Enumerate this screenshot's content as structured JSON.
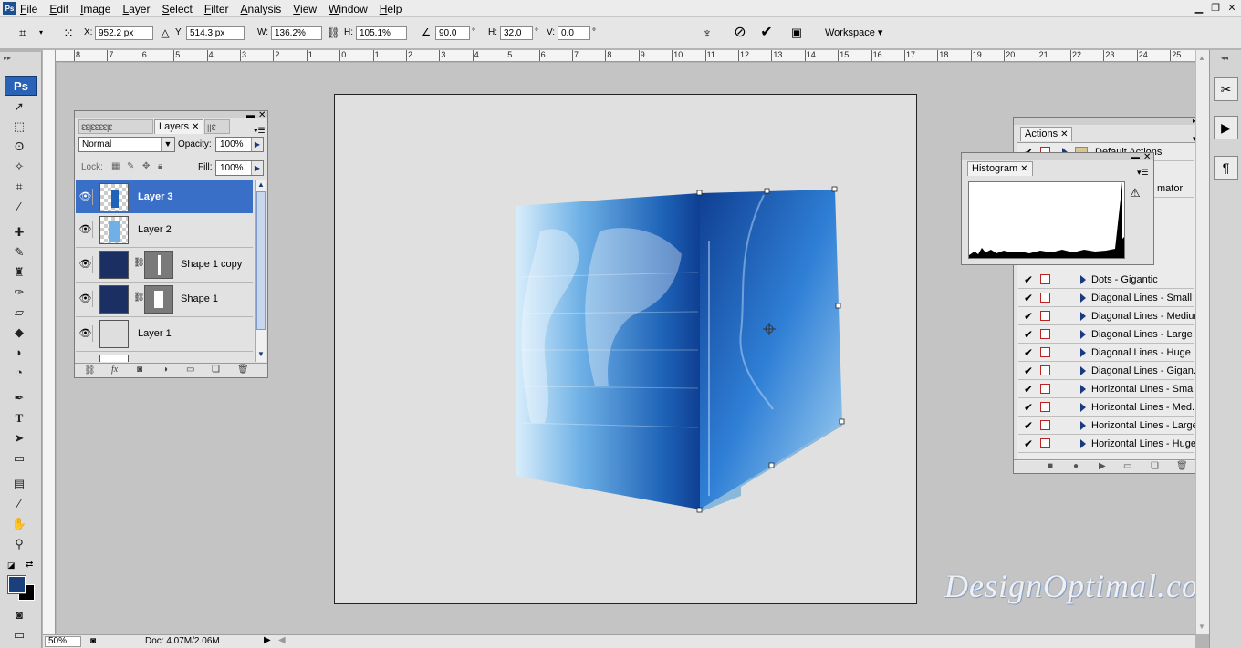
{
  "menu": [
    "File",
    "Edit",
    "Image",
    "Layer",
    "Select",
    "Filter",
    "Analysis",
    "View",
    "Window",
    "Help"
  ],
  "app_badge": "Ps",
  "options": {
    "x_label": "X:",
    "x_value": "952.2 px",
    "y_label": "Y:",
    "y_value": "514.3 px",
    "w_label": "W:",
    "w_value": "136.2%",
    "h_label": "H:",
    "h_value": "105.1%",
    "angle_value": "90.0",
    "angle_unit": "°",
    "hskew_label": "H:",
    "hskew_value": "32.0",
    "hskew_unit": "°",
    "vskew_label": "V:",
    "vskew_value": "0.0",
    "vskew_unit": "°",
    "workspace": "Workspace"
  },
  "ruler_ticks": [
    "8",
    "7",
    "6",
    "5",
    "4",
    "3",
    "2",
    "1",
    "0",
    "1",
    "2",
    "3",
    "4",
    "5",
    "6",
    "7",
    "8",
    "9",
    "10",
    "11",
    "12",
    "13",
    "14",
    "15",
    "16",
    "17",
    "18",
    "19",
    "20",
    "21",
    "22",
    "23",
    "24",
    "25",
    "26"
  ],
  "layers_panel": {
    "tab": "Layers",
    "blend_mode": "Normal",
    "opacity_label": "Opacity:",
    "opacity_value": "100%",
    "lock_label": "Lock:",
    "fill_label": "Fill:",
    "fill_value": "100%",
    "layers": [
      {
        "name": "Layer 3",
        "selected": true
      },
      {
        "name": "Layer 2",
        "selected": false
      },
      {
        "name": "Shape 1 copy",
        "selected": false
      },
      {
        "name": "Shape 1",
        "selected": false
      },
      {
        "name": "Layer 1",
        "selected": false
      }
    ]
  },
  "histogram_panel": {
    "tab": "Histogram"
  },
  "actions_panel": {
    "tab": "Actions",
    "set_name": "Default Actions",
    "partial_item": "mator",
    "items": [
      "Dots - Gigantic",
      "Diagonal Lines - Small",
      "Diagonal Lines - Medium",
      "Diagonal Lines - Large",
      "Diagonal Lines - Huge",
      "Diagonal Lines - Gigan...",
      "Horizontal Lines - Small",
      "Horizontal Lines - Med...",
      "Horizontal Lines - Large",
      "Horizontal Lines - Huge"
    ]
  },
  "status": {
    "zoom": "50%",
    "doc": "Doc: 4.07M/2.06M"
  },
  "watermark": "DesignOptimal.com",
  "colors": {
    "accent": "#3a6fc8",
    "foreground": "#1b3f7a",
    "background": "#000000",
    "cube_dark": "#0f3f92",
    "cube_light": "#9fd2f2"
  }
}
